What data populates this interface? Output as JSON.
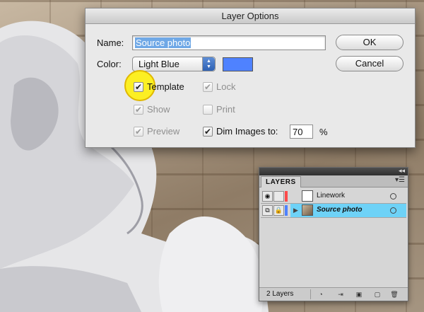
{
  "dialog": {
    "title": "Layer Options",
    "name_label": "Name:",
    "name_value": "Source photo",
    "color_label": "Color:",
    "color_value": "Light Blue",
    "color_swatch": "#4f82ff",
    "ok_label": "OK",
    "cancel_label": "Cancel",
    "options": {
      "template": {
        "label": "Template",
        "checked": true,
        "enabled": true
      },
      "lock": {
        "label": "Lock",
        "checked": true,
        "enabled": false
      },
      "show": {
        "label": "Show",
        "checked": true,
        "enabled": false
      },
      "print": {
        "label": "Print",
        "checked": false,
        "enabled": false
      },
      "preview": {
        "label": "Preview",
        "checked": true,
        "enabled": false
      },
      "dim": {
        "label": "Dim Images to:",
        "checked": true,
        "enabled": true
      }
    },
    "dim_value": "70",
    "dim_unit": "%"
  },
  "layers_panel": {
    "tab_label": "LAYERS",
    "layers": [
      {
        "name": "Linework",
        "color": "#ff4b4b",
        "selected": false
      },
      {
        "name": "Source photo",
        "color": "#4f82ff",
        "selected": true
      }
    ],
    "count_label": "2 Layers",
    "accent": "#6ed2f7"
  }
}
